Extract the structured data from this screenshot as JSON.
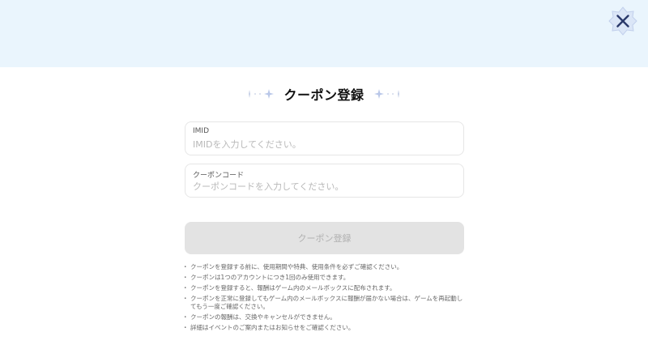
{
  "dialog": {
    "title": "クーポン登録",
    "close_icon": "close-icon",
    "sparkle_icon": "sparkle-icon"
  },
  "form": {
    "imid": {
      "label": "IMID",
      "placeholder": "IMIDを入力してください。",
      "value": ""
    },
    "coupon_code": {
      "label": "クーポンコード",
      "placeholder": "クーポンコードを入力してください。",
      "value": ""
    },
    "submit_label": "クーポン登録"
  },
  "notes": [
    "クーポンを登録する前に、使用期間や特典、使用条件を必ずご確認ください。",
    "クーポンは1つのアカウントにつき1回のみ使用できます。",
    "クーポンを登録すると、報酬はゲーム内のメールボックスに配布されます。",
    "クーポンを正常に登録してもゲーム内のメールボックスに報酬が届かない場合は、ゲームを再起動してもう一度ご確認ください。",
    "クーポンの報酬は、交換やキャンセルができません。",
    "詳細はイベントのご案内またはお知らせをご確認ください。"
  ],
  "colors": {
    "top_band": "#eaf5fd",
    "button_disabled": "#e3e3e3",
    "sparkle": "#b9c7e8",
    "close_x": "#2b3a6b"
  }
}
